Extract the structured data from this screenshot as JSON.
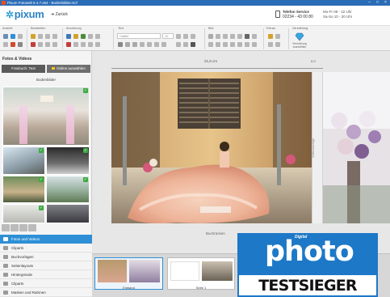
{
  "window": {
    "title": "Pixum Fotowelt 6.4.7.x64 - Bodenbilder.mcf"
  },
  "header": {
    "logo_text": "pixum",
    "back_label": "Zurück",
    "service_title": "Telefon Service",
    "service_phone": "02234 - 43 00 80",
    "hours_line1": "Mo-Fr 08 - 22 Uhr",
    "hours_line2": "Sa-So 10 - 20 Uhr"
  },
  "ribbon": {
    "groups": [
      "Ansicht",
      "Bearbeiten",
      "Anordnung",
      "Text",
      "Bild",
      "Extras",
      "Veredelung"
    ],
    "font_value": "Calibri",
    "size_value": "12",
    "finish_label": "Veredelung auswählen"
  },
  "left_panel": {
    "title": "Fotos & Videos",
    "folder_button": "Fotobuch: Text",
    "online_button": "Online auswählen",
    "folder_label": "Bodenbilder",
    "nav": [
      {
        "label": "Fotos und Videos",
        "icon": "photos-icon",
        "active": true
      },
      {
        "label": "Cliparts",
        "icon": "clipart-icon",
        "active": false
      },
      {
        "label": "Buchvorlagen",
        "icon": "book-icon",
        "active": false
      },
      {
        "label": "Seitenlayouts",
        "icon": "layout-icon",
        "active": false
      },
      {
        "label": "Hintergründe",
        "icon": "background-icon",
        "active": false
      },
      {
        "label": "Cliparts",
        "icon": "clipart2-icon",
        "active": false
      },
      {
        "label": "Masken und Rahmen",
        "icon": "frame-icon",
        "active": false
      }
    ]
  },
  "canvas": {
    "width_label": "21,6 cm",
    "spine_width": "0,9",
    "spine_text": "Seitenanzeige",
    "page_label": "Buchrücken"
  },
  "filmstrip": {
    "pages": [
      "Einband",
      "Seite 1"
    ]
  },
  "badge": {
    "digital": "Digital",
    "photo": "photo",
    "testsieger": "TESTSIEGER"
  },
  "colors": {
    "accent": "#2e8fd6",
    "badge_blue": "#1d78c7",
    "check_green": "#3aab3f"
  }
}
